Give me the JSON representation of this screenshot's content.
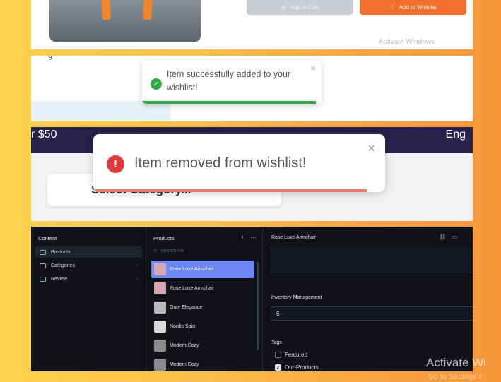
{
  "panel1": {
    "add_to_cart": "Add to Cart",
    "add_to_wishlist": "Add to Wishlist",
    "activate_windows": "Activate Windows",
    "cart_icon": "cart-icon",
    "heart_icon": "heart-icon"
  },
  "panel2": {
    "fragment": "g",
    "toast_message": "Item successfully added to your wishlist!",
    "toast_close": "×",
    "success_color": "#2eaa47"
  },
  "panel3": {
    "nav_left": "r $50",
    "nav_right": "Eng",
    "select_placeholder": "Select Category...",
    "toast_message": "Item removed from wishlist!",
    "toast_close": "×",
    "error_color": "#e03a3a",
    "error_mark": "!"
  },
  "cms": {
    "content_title": "Content",
    "nav_items": [
      {
        "label": "Products",
        "active": true
      },
      {
        "label": "Categories",
        "active": false
      },
      {
        "label": "Review",
        "active": false
      }
    ],
    "products_title": "Products",
    "add_symbol": "+",
    "more_symbol": "···",
    "search_placeholder": "Search list",
    "products": [
      {
        "name": "Rose Luxe Armchair",
        "selected": true,
        "thumb": "#d7a7b5"
      },
      {
        "name": "Rose Luxe Armchair",
        "selected": false,
        "thumb": "#d7a7b5"
      },
      {
        "name": "Gray Elegance",
        "selected": false,
        "thumb": "#b9b9b9"
      },
      {
        "name": "Nordic Spin",
        "selected": false,
        "thumb": "#d9d9d9"
      },
      {
        "name": "Modern Cozy",
        "selected": false,
        "thumb": "#8c8c8c"
      },
      {
        "name": "Modern Cozy",
        "selected": false,
        "thumb": "#8c8c8c"
      }
    ],
    "detail_title": "Rose Luxe Armchair",
    "inventory_label": "Inventory Management",
    "inventory_value": "6",
    "tags_label": "Tags",
    "tags": [
      {
        "label": "Featured",
        "checked": false
      },
      {
        "label": "Our-Products",
        "checked": true
      }
    ],
    "accent_color": "#6e89f7"
  },
  "watermark": {
    "line1": "Activate Wi",
    "line2": "Go to Settings t"
  }
}
